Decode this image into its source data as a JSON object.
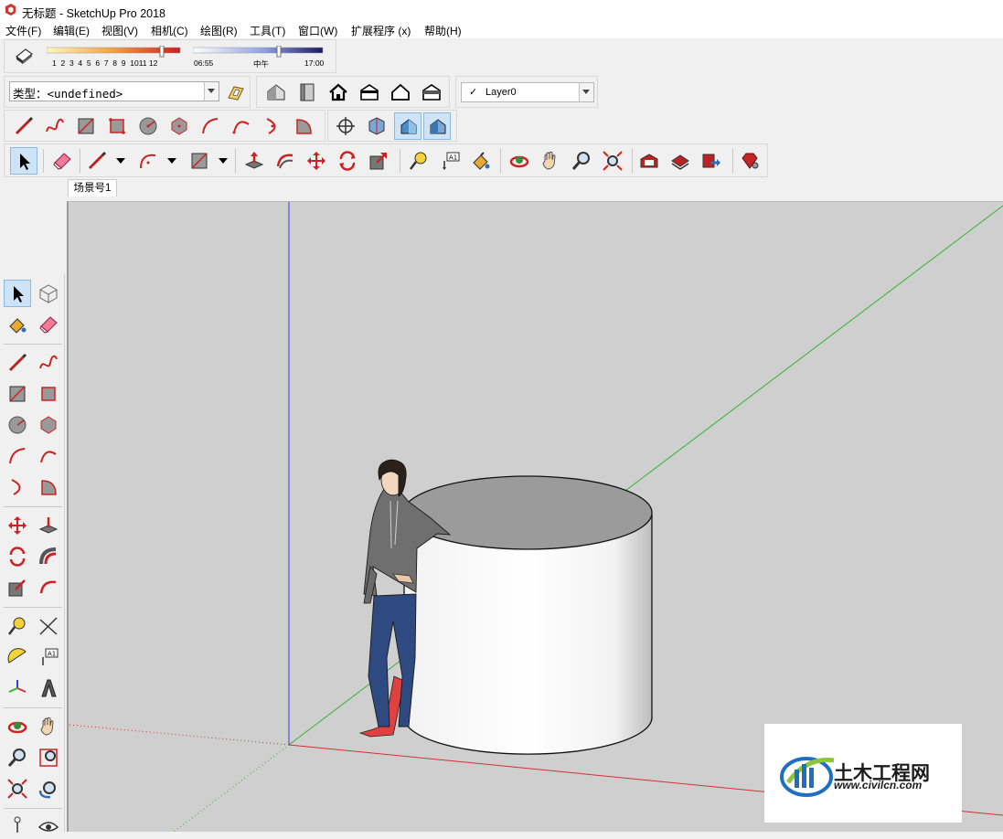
{
  "window": {
    "title": "无标题 - SketchUp Pro 2018"
  },
  "menu": [
    "文件(F)",
    "编辑(E)",
    "视图(V)",
    "相机(C)",
    "绘图(R)",
    "工具(T)",
    "窗口(W)",
    "扩展程序 (x)",
    "帮助(H)"
  ],
  "shadow": {
    "months": [
      "1",
      "2",
      "3",
      "4",
      "5",
      "6",
      "7",
      "8",
      "9",
      "10",
      "11",
      "12"
    ],
    "time_start": "06:55",
    "time_mid": "中午",
    "time_end": "17:00"
  },
  "entity": {
    "label": "类型：",
    "value": "<undefined>"
  },
  "layer": {
    "check": "✓",
    "name": "Layer0"
  },
  "scene_tab": "场景号1",
  "watermark": {
    "name": "土木工程网",
    "url": "www.civilcn.com"
  },
  "colors": {
    "viewport": "#cfcfcf",
    "selected": "#cde3f7",
    "red_axis": "#d23232",
    "green_axis": "#32b432",
    "blue_axis": "#3c3cdc"
  }
}
